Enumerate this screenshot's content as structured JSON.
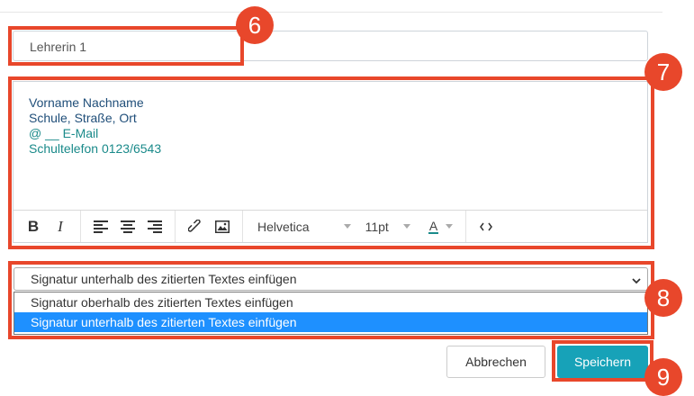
{
  "signature_name": {
    "value": "Lehrerin 1"
  },
  "editor": {
    "lines": [
      "Vorname Nachname",
      "Schule, Straße, Ort",
      "@ __ E-Mail",
      "Schultelefon 0123/6543"
    ],
    "font_family": "Helvetica",
    "font_size": "11pt",
    "font_color_label": "A",
    "colors": {
      "name_lines": "#1f4e79",
      "contact_lines": "#1a8a8a"
    },
    "toolbar_icons": [
      "bold-icon",
      "italic-icon",
      "align-left-icon",
      "align-center-icon",
      "align-right-icon",
      "link-icon",
      "image-icon",
      "font-color-icon",
      "source-code-icon"
    ]
  },
  "position_select": {
    "selected": "Signatur unterhalb des zitierten Textes einfügen",
    "options": [
      "Signatur oberhalb des zitierten Textes einfügen",
      "Signatur unterhalb des zitierten Textes einfügen"
    ]
  },
  "actions": {
    "cancel_label": "Abbrechen",
    "save_label": "Speichern",
    "save_color": "#17a2b8"
  },
  "annotations": {
    "accent": "#e8472b",
    "badges": [
      "6",
      "7",
      "8",
      "9"
    ]
  }
}
